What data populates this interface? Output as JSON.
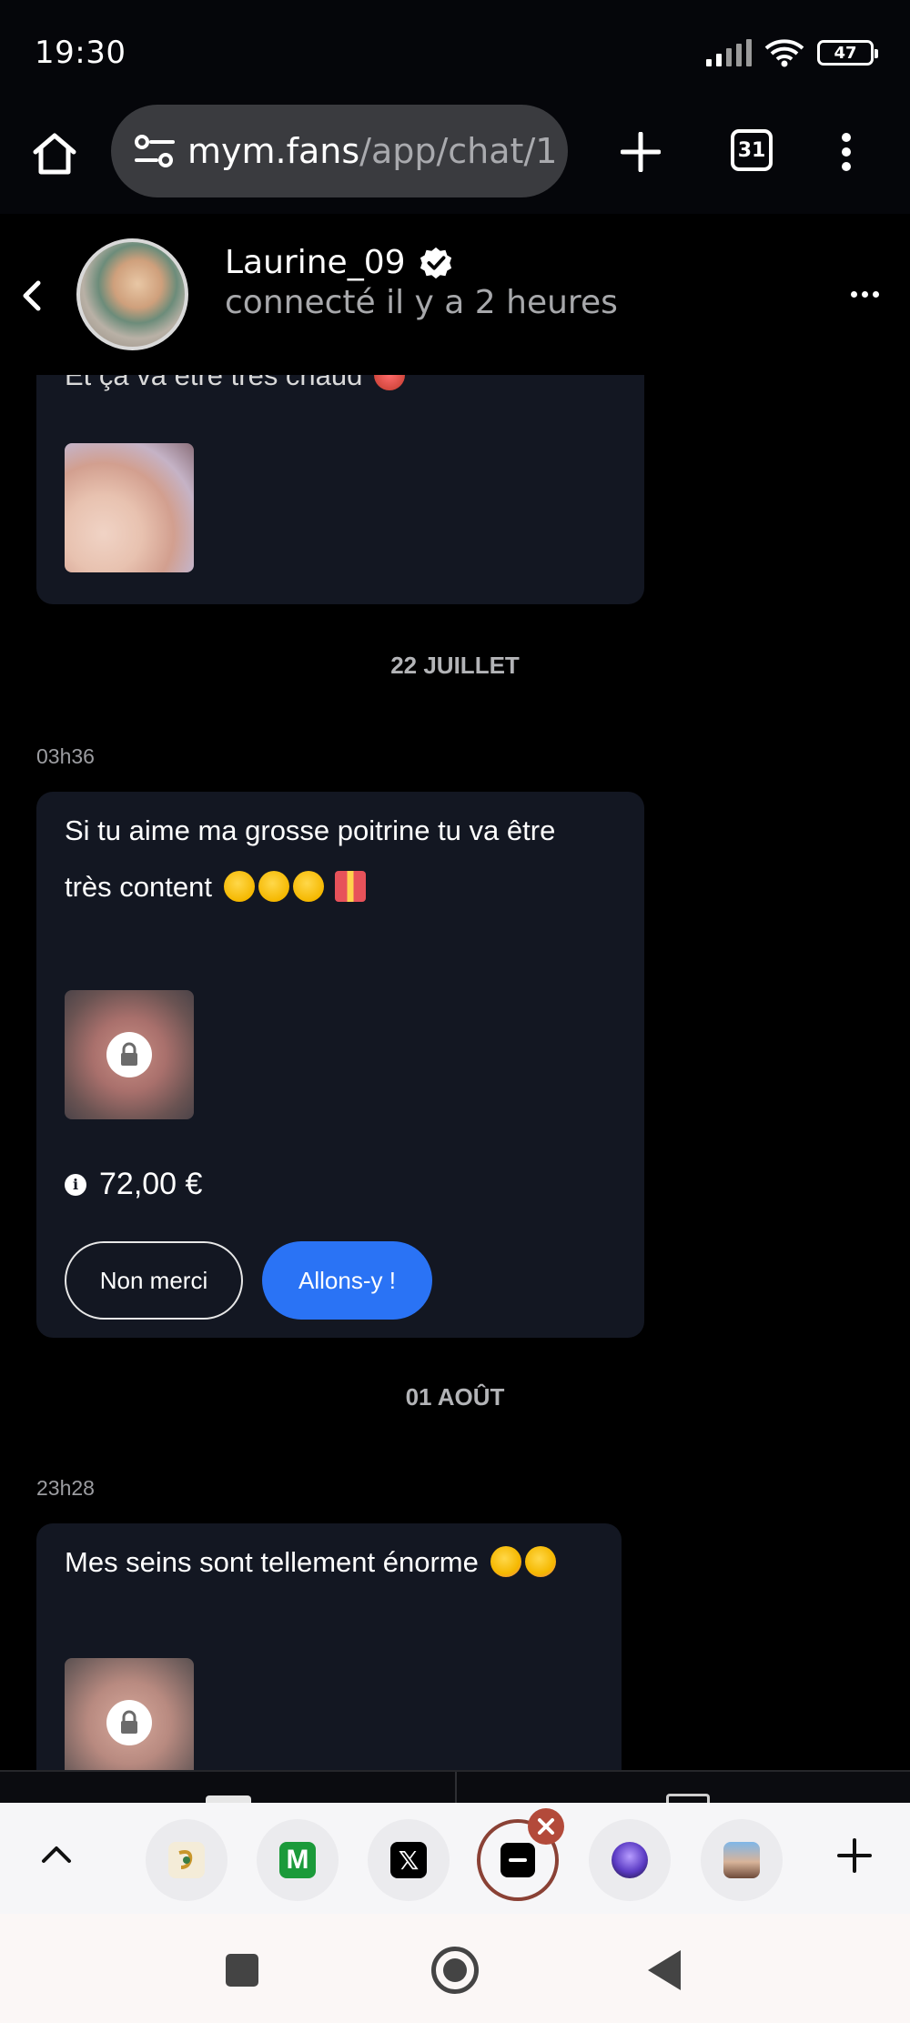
{
  "status_bar": {
    "time": "19:30",
    "battery": "47"
  },
  "browser": {
    "url_domain": "mym.fans",
    "url_path": "/app/chat/1",
    "tab_count": "31"
  },
  "chat_header": {
    "username": "Laurine_09",
    "presence": "connecté il y a 2 heures"
  },
  "messages": {
    "partial_top_text": "Et ça va être très chaud",
    "date1": "22 JUILLET",
    "time1": "03h36",
    "msg1_line1": "Si tu aime ma grosse poitrine tu va être",
    "msg1_line2": "très content",
    "price1": "72,00 €",
    "decline_label": "Non merci",
    "accept_label": "Allons-y !",
    "date2": "01 AOÛT",
    "time2": "23h28",
    "msg2": "Mes seins sont tellement énorme"
  },
  "tab_strip": {
    "tabs": [
      "site-icon-1",
      "site-icon-m",
      "x-icon",
      "mym-icon",
      "site-icon-5",
      "site-icon-6"
    ]
  },
  "colors": {
    "accent": "#2a73f5",
    "bubble": "#131722",
    "background": "#000000"
  }
}
